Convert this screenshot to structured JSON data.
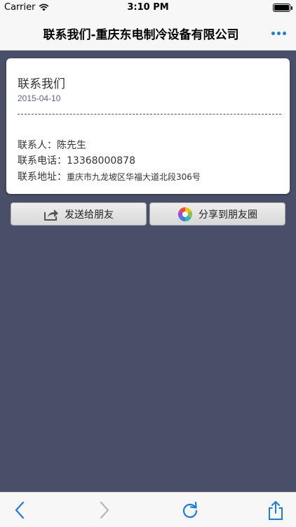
{
  "status_bar": {
    "carrier": "Carrier",
    "time": "3:10 PM"
  },
  "nav": {
    "title": "联系我们-重庆东电制冷设备有限公司"
  },
  "card": {
    "title": "联系我们",
    "date": "2015-04-10",
    "contact_label": "联系人：",
    "contact_value": "陈先生",
    "phone_label": "联系电话：",
    "phone_value": "13368000878",
    "address_label": "联系地址：",
    "address_value": "重庆市九龙坡区华福大道北段306号"
  },
  "actions": {
    "send_label": "发送给朋友",
    "share_label": "分享到朋友圈"
  },
  "colors": {
    "accent": "#1a7ce8",
    "content_bg": "#494e69",
    "date_text": "#5a648a"
  },
  "icons": {
    "wifi": "wifi-icon",
    "battery": "battery-icon",
    "more": "more-icon",
    "send": "share-arrow-icon",
    "moments": "moments-icon",
    "back": "back-chevron-icon",
    "forward": "forward-chevron-icon",
    "refresh": "refresh-icon",
    "share": "share-icon"
  }
}
